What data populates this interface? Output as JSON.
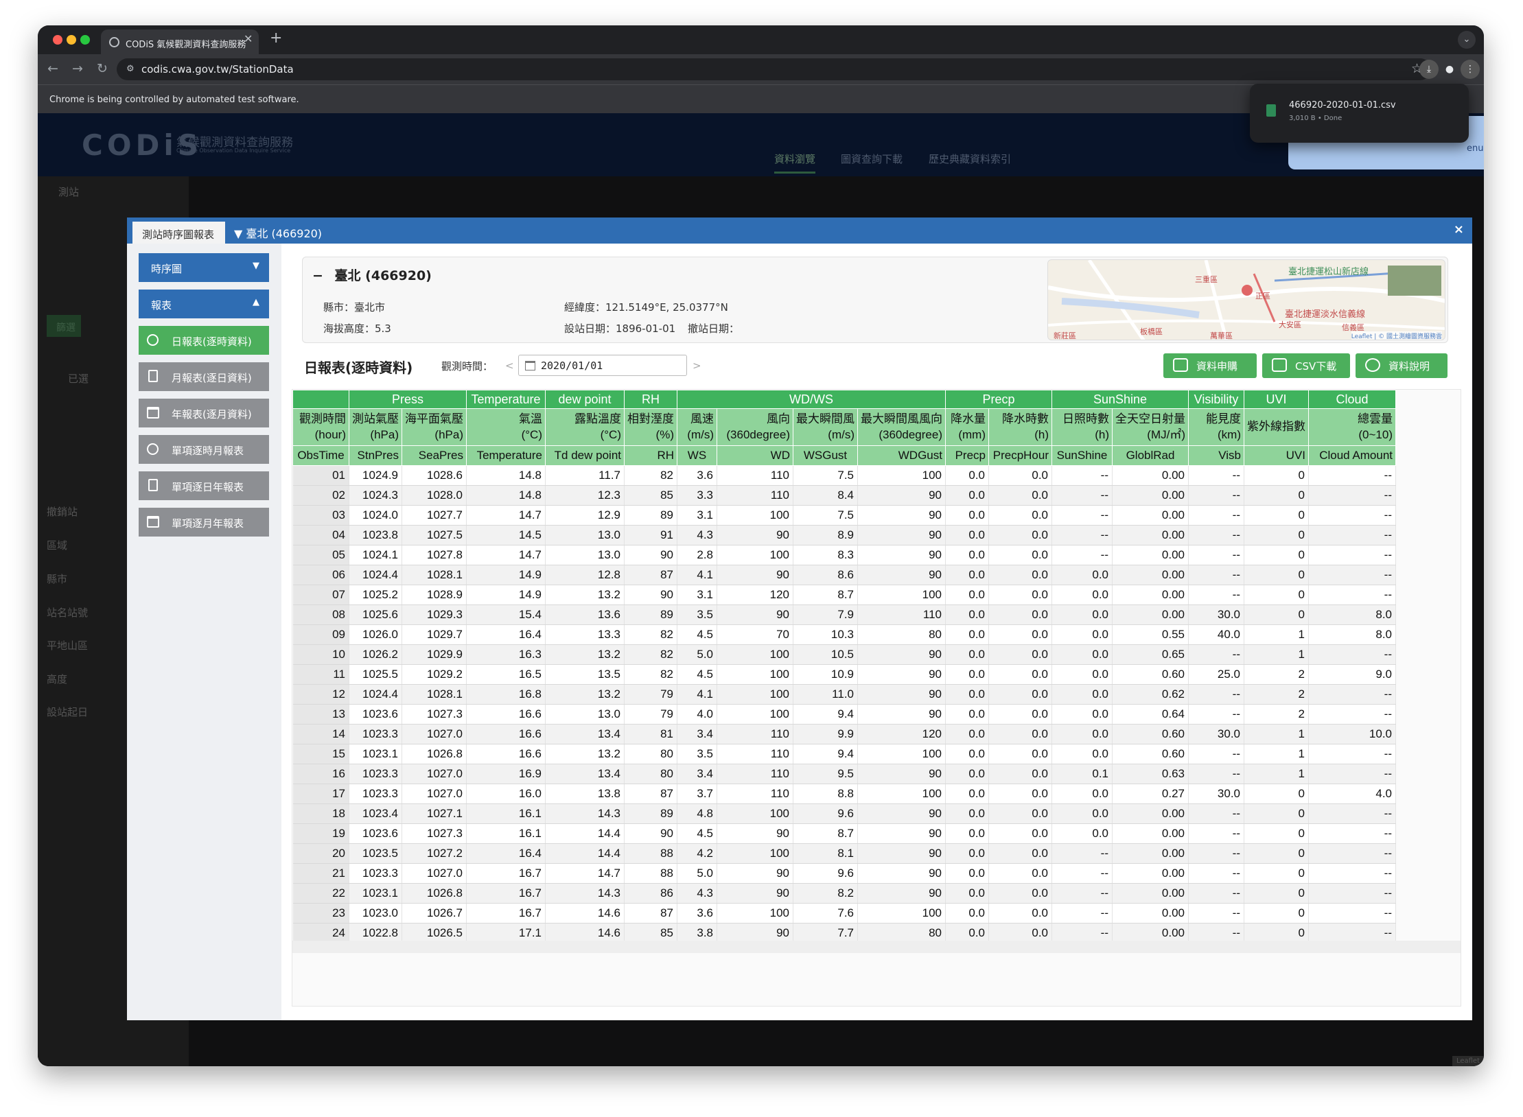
{
  "browser": {
    "tab_title": "CODiS 氣候觀測資料查詢服務",
    "url": "codis.cwa.gov.tw/StationData",
    "infobar": "Chrome is being controlled by automated test software.",
    "download": {
      "filename": "466920-2020-01-01.csv",
      "status": "3,010 B • Done"
    },
    "menu_fragment": "enu"
  },
  "site": {
    "logo": "CODiS",
    "logo_sub": "氣候觀測資料查詢服務",
    "logo_sub_en": "Climate Observation Data Inquire Service",
    "nav": [
      "資料瀏覽",
      "圖資查詢下載",
      "歷史典藏資料索引"
    ],
    "left_bits": [
      "測站",
      "篩選",
      "已選",
      "撤銷站",
      "區域",
      "縣市",
      "站名站號",
      "平地山區",
      "高度",
      "設站起日"
    ],
    "map_credit": "Leaflet"
  },
  "modal": {
    "tab1": "測站時序圖報表",
    "tab2": "▼ 臺北 (466920)",
    "close": "×",
    "sidebar": [
      {
        "label": "時序圖",
        "caret": "▼"
      },
      {
        "label": "報表",
        "caret": "▲"
      },
      {
        "label": "日報表(逐時資料)"
      },
      {
        "label": "月報表(逐日資料)"
      },
      {
        "label": "年報表(逐月資料)"
      },
      {
        "label": "單項逐時月報表"
      },
      {
        "label": "單項逐日年報表"
      },
      {
        "label": "單項逐月年報表"
      }
    ],
    "station": {
      "collapse": "−",
      "name": "臺北 (466920)",
      "county": "縣市：臺北市",
      "altitude": "海拔高度：5.3",
      "coords": "經緯度：121.5149°E, 25.0377°N",
      "established": "設站日期：1896-01-01",
      "removed": "撤站日期："
    },
    "map_labels": [
      "臺北捷運松山新店線",
      "臺北捷運淡水信義線",
      "三重區",
      "正區",
      "大安區",
      "萬華區",
      "新莊區",
      "板橋區",
      "信義區",
      "Leaflet | © 國土測繪圖資服務雲"
    ],
    "report_title": "日報表(逐時資料)",
    "obs_label": "觀測時間：",
    "prev": "<",
    "next": ">",
    "date": "2020/01/01",
    "buttons": [
      "資料申購",
      "CSV下載",
      "資料說明"
    ]
  },
  "table": {
    "groups": [
      {
        "label": "",
        "span": 1
      },
      {
        "label": "Press",
        "span": 2
      },
      {
        "label": "Temperature",
        "span": 1
      },
      {
        "label": "dew point",
        "span": 1
      },
      {
        "label": "RH",
        "span": 1
      },
      {
        "label": "WD/WS",
        "span": 4
      },
      {
        "label": "Precp",
        "span": 2
      },
      {
        "label": "SunShine",
        "span": 2
      },
      {
        "label": "Visibility",
        "span": 1
      },
      {
        "label": "UVI",
        "span": 1
      },
      {
        "label": "Cloud",
        "span": 1
      }
    ],
    "columns_zh": [
      [
        "觀測時間",
        "(hour)"
      ],
      [
        "測站氣壓",
        "(hPa)"
      ],
      [
        "海平面氣壓",
        "(hPa)"
      ],
      [
        "氣溫",
        "(°C)"
      ],
      [
        "露點溫度",
        "(°C)"
      ],
      [
        "相對溼度",
        "(%)"
      ],
      [
        "風速",
        "(m/s)"
      ],
      [
        "風向",
        "(360degree)"
      ],
      [
        "最大瞬間風",
        "(m/s)"
      ],
      [
        "最大瞬間風風向",
        "(360degree)"
      ],
      [
        "降水量",
        "(mm)"
      ],
      [
        "降水時數",
        "(h)"
      ],
      [
        "日照時數",
        "(h)"
      ],
      [
        "全天空日射量",
        "(MJ/㎡)"
      ],
      [
        "能見度",
        "(km)"
      ],
      [
        "紫外線指數",
        ""
      ],
      [
        "總雲量",
        "(0~10)"
      ]
    ],
    "columns_en": [
      "ObsTime",
      "StnPres",
      "SeaPres",
      "Temperature",
      "Td dew point",
      "RH",
      "WS",
      "WD",
      "WSGust",
      "WDGust",
      "Precp",
      "PrecpHour",
      "SunShine",
      "GloblRad",
      "Visb",
      "UVI",
      "Cloud Amount"
    ],
    "rows": [
      [
        "01",
        "1024.9",
        "1028.6",
        "14.8",
        "11.7",
        "82",
        "3.6",
        "110",
        "7.5",
        "100",
        "0.0",
        "0.0",
        "--",
        "0.00",
        "--",
        "0",
        "--"
      ],
      [
        "02",
        "1024.3",
        "1028.0",
        "14.8",
        "12.3",
        "85",
        "3.3",
        "110",
        "8.4",
        "90",
        "0.0",
        "0.0",
        "--",
        "0.00",
        "--",
        "0",
        "--"
      ],
      [
        "03",
        "1024.0",
        "1027.7",
        "14.7",
        "12.9",
        "89",
        "3.1",
        "100",
        "7.5",
        "90",
        "0.0",
        "0.0",
        "--",
        "0.00",
        "--",
        "0",
        "--"
      ],
      [
        "04",
        "1023.8",
        "1027.5",
        "14.5",
        "13.0",
        "91",
        "4.3",
        "90",
        "8.9",
        "90",
        "0.0",
        "0.0",
        "--",
        "0.00",
        "--",
        "0",
        "--"
      ],
      [
        "05",
        "1024.1",
        "1027.8",
        "14.7",
        "13.0",
        "90",
        "2.8",
        "100",
        "8.3",
        "90",
        "0.0",
        "0.0",
        "--",
        "0.00",
        "--",
        "0",
        "--"
      ],
      [
        "06",
        "1024.4",
        "1028.1",
        "14.9",
        "12.8",
        "87",
        "4.1",
        "90",
        "8.6",
        "90",
        "0.0",
        "0.0",
        "0.0",
        "0.00",
        "--",
        "0",
        "--"
      ],
      [
        "07",
        "1025.2",
        "1028.9",
        "14.9",
        "13.2",
        "90",
        "3.1",
        "120",
        "8.7",
        "100",
        "0.0",
        "0.0",
        "0.0",
        "0.00",
        "--",
        "0",
        "--"
      ],
      [
        "08",
        "1025.6",
        "1029.3",
        "15.4",
        "13.6",
        "89",
        "3.5",
        "90",
        "7.9",
        "110",
        "0.0",
        "0.0",
        "0.0",
        "0.00",
        "30.0",
        "0",
        "8.0"
      ],
      [
        "09",
        "1026.0",
        "1029.7",
        "16.4",
        "13.3",
        "82",
        "4.5",
        "70",
        "10.3",
        "80",
        "0.0",
        "0.0",
        "0.0",
        "0.55",
        "40.0",
        "1",
        "8.0"
      ],
      [
        "10",
        "1026.2",
        "1029.9",
        "16.3",
        "13.2",
        "82",
        "5.0",
        "100",
        "10.5",
        "90",
        "0.0",
        "0.0",
        "0.0",
        "0.65",
        "--",
        "1",
        "--"
      ],
      [
        "11",
        "1025.5",
        "1029.2",
        "16.5",
        "13.5",
        "82",
        "4.5",
        "100",
        "10.9",
        "90",
        "0.0",
        "0.0",
        "0.0",
        "0.60",
        "25.0",
        "2",
        "9.0"
      ],
      [
        "12",
        "1024.4",
        "1028.1",
        "16.8",
        "13.2",
        "79",
        "4.1",
        "100",
        "11.0",
        "90",
        "0.0",
        "0.0",
        "0.0",
        "0.62",
        "--",
        "2",
        "--"
      ],
      [
        "13",
        "1023.6",
        "1027.3",
        "16.6",
        "13.0",
        "79",
        "4.0",
        "100",
        "9.4",
        "90",
        "0.0",
        "0.0",
        "0.0",
        "0.64",
        "--",
        "2",
        "--"
      ],
      [
        "14",
        "1023.3",
        "1027.0",
        "16.6",
        "13.4",
        "81",
        "3.4",
        "110",
        "9.9",
        "120",
        "0.0",
        "0.0",
        "0.0",
        "0.60",
        "30.0",
        "1",
        "10.0"
      ],
      [
        "15",
        "1023.1",
        "1026.8",
        "16.6",
        "13.2",
        "80",
        "3.5",
        "110",
        "9.4",
        "100",
        "0.0",
        "0.0",
        "0.0",
        "0.60",
        "--",
        "1",
        "--"
      ],
      [
        "16",
        "1023.3",
        "1027.0",
        "16.9",
        "13.4",
        "80",
        "3.4",
        "110",
        "9.5",
        "90",
        "0.0",
        "0.0",
        "0.1",
        "0.63",
        "--",
        "1",
        "--"
      ],
      [
        "17",
        "1023.3",
        "1027.0",
        "16.0",
        "13.8",
        "87",
        "3.7",
        "110",
        "8.8",
        "100",
        "0.0",
        "0.0",
        "0.0",
        "0.27",
        "30.0",
        "0",
        "4.0"
      ],
      [
        "18",
        "1023.4",
        "1027.1",
        "16.1",
        "14.3",
        "89",
        "4.8",
        "100",
        "9.6",
        "90",
        "0.0",
        "0.0",
        "0.0",
        "0.00",
        "--",
        "0",
        "--"
      ],
      [
        "19",
        "1023.6",
        "1027.3",
        "16.1",
        "14.4",
        "90",
        "4.5",
        "90",
        "8.7",
        "90",
        "0.0",
        "0.0",
        "0.0",
        "0.00",
        "--",
        "0",
        "--"
      ],
      [
        "20",
        "1023.5",
        "1027.2",
        "16.4",
        "14.4",
        "88",
        "4.2",
        "100",
        "8.1",
        "90",
        "0.0",
        "0.0",
        "--",
        "0.00",
        "--",
        "0",
        "--"
      ],
      [
        "21",
        "1023.3",
        "1027.0",
        "16.7",
        "14.7",
        "88",
        "5.0",
        "90",
        "9.6",
        "90",
        "0.0",
        "0.0",
        "--",
        "0.00",
        "--",
        "0",
        "--"
      ],
      [
        "22",
        "1023.1",
        "1026.8",
        "16.7",
        "14.3",
        "86",
        "4.3",
        "90",
        "8.2",
        "90",
        "0.0",
        "0.0",
        "--",
        "0.00",
        "--",
        "0",
        "--"
      ],
      [
        "23",
        "1023.0",
        "1026.7",
        "16.7",
        "14.6",
        "87",
        "3.6",
        "100",
        "7.6",
        "100",
        "0.0",
        "0.0",
        "--",
        "0.00",
        "--",
        "0",
        "--"
      ],
      [
        "24",
        "1022.8",
        "1026.5",
        "17.1",
        "14.6",
        "85",
        "3.8",
        "90",
        "7.7",
        "80",
        "0.0",
        "0.0",
        "--",
        "0.00",
        "--",
        "0",
        "--"
      ]
    ]
  }
}
